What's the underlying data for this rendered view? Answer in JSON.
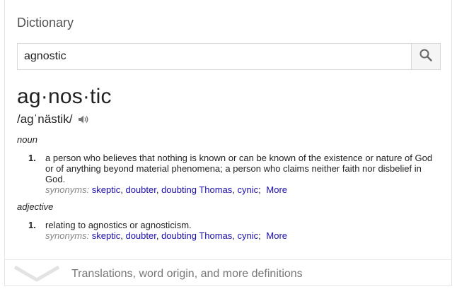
{
  "card": {
    "title": "Dictionary",
    "search": {
      "value": "agnostic",
      "icon": "search-icon"
    },
    "headword": "ag·nos·tic",
    "pronunciation": "/agˈnästik/",
    "entries": [
      {
        "pos": "noun",
        "senses": [
          {
            "number": "1.",
            "definition": "a person who believes that nothing is known or can be known of the existence or nature of God or of anything beyond material phenomena; a person who claims neither faith nor disbelief in God.",
            "synonyms_label": "synonyms:",
            "synonyms": [
              "skeptic",
              "doubter",
              "doubting Thomas",
              "cynic"
            ],
            "more": "More"
          }
        ]
      },
      {
        "pos": "adjective",
        "senses": [
          {
            "number": "1.",
            "definition": "relating to agnostics or agnosticism.",
            "synonyms_label": "synonyms:",
            "synonyms": [
              "skeptic",
              "doubter",
              "doubting Thomas",
              "cynic"
            ],
            "more": "More"
          }
        ]
      }
    ],
    "footer": {
      "label": "Translations, word origin, and more definitions",
      "icon": "chevron-down-icon"
    }
  },
  "colors": {
    "link": "#1a0dab",
    "muted": "#878787",
    "text": "#222222"
  }
}
